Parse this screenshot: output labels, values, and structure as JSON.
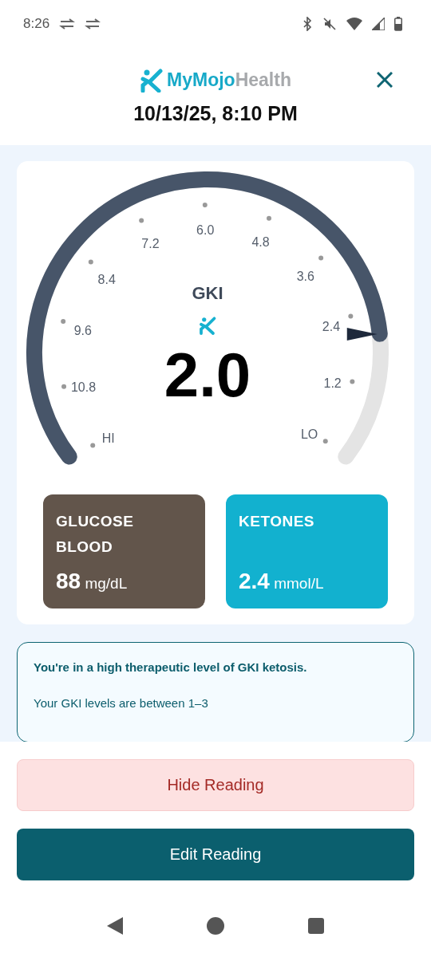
{
  "status_bar": {
    "time": "8:26"
  },
  "header": {
    "brand_primary": "MyMojo",
    "brand_secondary": "Health",
    "datetime": "10/13/25, 8:10 PM"
  },
  "gauge": {
    "title": "GKI",
    "value": "2.0",
    "ticks": [
      "HI",
      "10.8",
      "9.6",
      "8.4",
      "7.2",
      "6.0",
      "4.8",
      "3.6",
      "2.4",
      "1.2",
      "LO"
    ]
  },
  "metrics": [
    {
      "label": "GLUCOSE BLOOD",
      "value": "88",
      "unit": "mg/dL",
      "color": "#62554b"
    },
    {
      "label": "KETONES",
      "value": "2.4",
      "unit": "mmol/L",
      "color": "#12b1cf"
    }
  ],
  "info": {
    "headline": "You're in a high therapeutic level of GKI ketosis.",
    "body": "Your GKI levels are between 1–3"
  },
  "buttons": [
    {
      "label": "Hide Reading",
      "kind": "secondary"
    },
    {
      "label": "Edit Reading",
      "kind": "primary"
    }
  ]
}
